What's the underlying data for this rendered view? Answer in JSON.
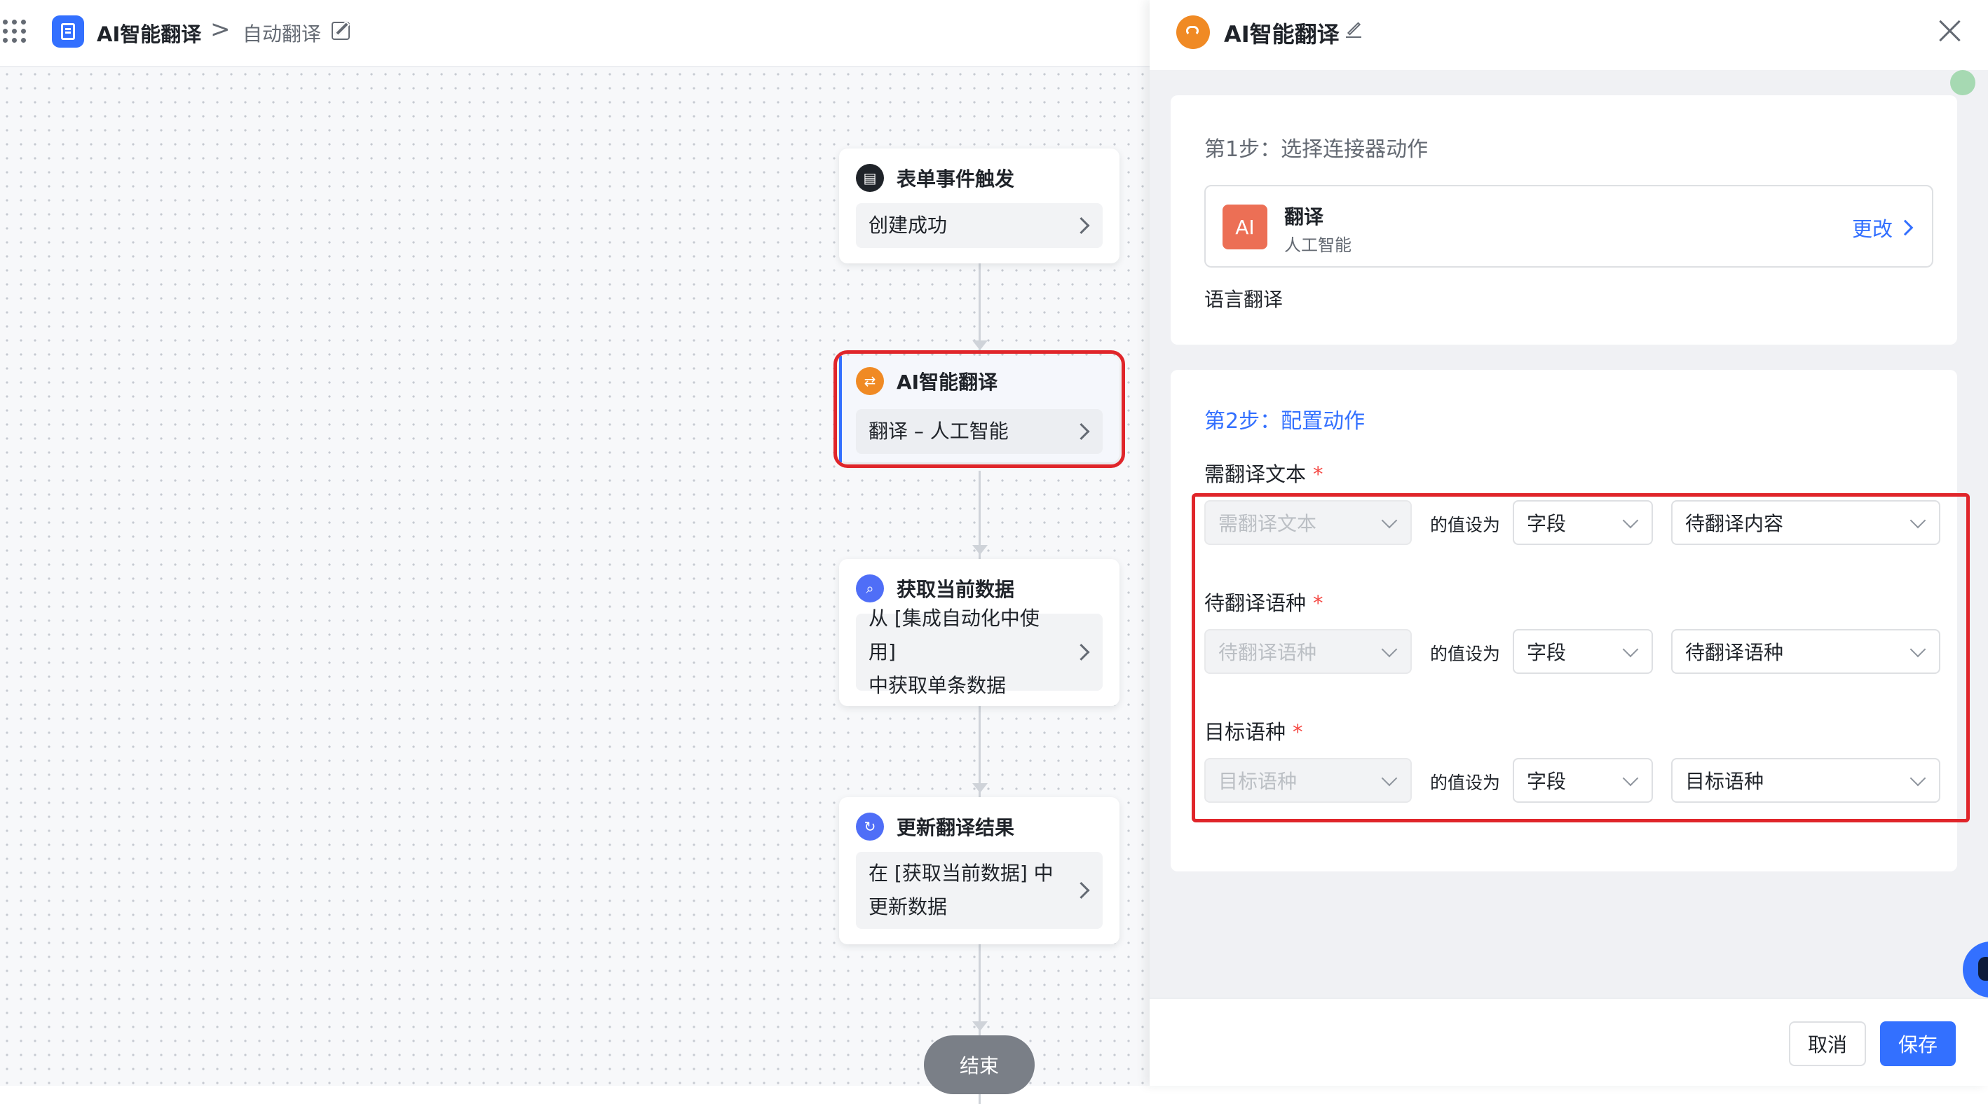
{
  "header": {
    "app_name": "AI智能翻译",
    "separator": ">",
    "page_name": "自动翻译"
  },
  "flow": {
    "nodes": [
      {
        "title": "表单事件触发",
        "body": "创建成功",
        "icon": "file-icon",
        "color": "#1f2329"
      },
      {
        "title": "AI智能翻译",
        "body": "翻译 – 人工智能",
        "icon": "translate-icon",
        "color": "#f08a24"
      },
      {
        "title": "获取当前数据",
        "body_lines": [
          "从 [集成自动化中使用]",
          "中获取单条数据"
        ],
        "icon": "search-icon",
        "color": "#4f6ef7"
      },
      {
        "title": "更新翻译结果",
        "body_lines": [
          "在 [获取当前数据] 中",
          "更新数据"
        ],
        "icon": "refresh-icon",
        "color": "#4f6ef7"
      }
    ],
    "end_label": "结束"
  },
  "panel": {
    "title": "AI智能翻译",
    "step1": {
      "title": "第1步：选择连接器动作",
      "badge": "AI",
      "connector_name": "翻译",
      "connector_category": "人工智能",
      "change_label": "更改",
      "action_label": "语言翻译"
    },
    "step2": {
      "title": "第2步：配置动作",
      "value_as_label": "的值设为",
      "fields": [
        {
          "label": "需翻译文本",
          "required": "*",
          "param": "需翻译文本",
          "source": "字段",
          "value": "待翻译内容"
        },
        {
          "label": "待翻译语种",
          "required": "*",
          "param": "待翻译语种",
          "source": "字段",
          "value": "待翻译语种"
        },
        {
          "label": "目标语种",
          "required": "*",
          "param": "目标语种",
          "source": "字段",
          "value": "目标语种"
        }
      ]
    },
    "footer": {
      "cancel_label": "取消",
      "save_label": "保存"
    }
  },
  "colors": {
    "accent": "#3370ff",
    "highlight": "#e0252a",
    "ai_badge": "#ec6f55"
  }
}
